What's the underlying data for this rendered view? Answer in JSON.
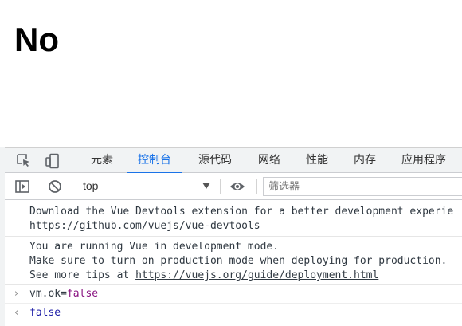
{
  "page": {
    "heading": "No"
  },
  "devtools": {
    "tabs": [
      "元素",
      "控制台",
      "源代码",
      "网络",
      "性能",
      "内存",
      "应用程序"
    ],
    "active_tab": "控制台",
    "toolbar": {
      "context": "top",
      "filter_placeholder": "筛选器"
    },
    "messages": [
      {
        "lines": [
          "Download the Vue Devtools extension for a better development experie"
        ],
        "link": "https://github.com/vuejs/vue-devtools"
      },
      {
        "lines": [
          "You are running Vue in development mode.",
          "Make sure to turn on production mode when deploying for production."
        ],
        "tip_prefix": "See more tips at ",
        "link": "https://vuejs.org/guide/deployment.html"
      },
      {
        "command": {
          "prefix": "vm.ok=",
          "value": "false"
        }
      },
      {
        "result": "false"
      }
    ],
    "colors": {
      "accent": "#1a73e8",
      "keyword": "#881280",
      "result": "#1a1aa6"
    }
  }
}
